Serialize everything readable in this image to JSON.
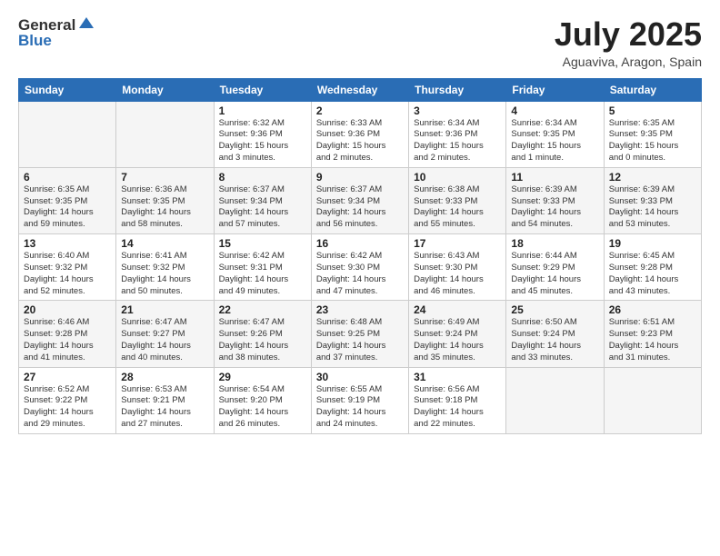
{
  "header": {
    "logo_line1": "General",
    "logo_line2": "Blue",
    "month_year": "July 2025",
    "location": "Aguaviva, Aragon, Spain"
  },
  "weekdays": [
    "Sunday",
    "Monday",
    "Tuesday",
    "Wednesday",
    "Thursday",
    "Friday",
    "Saturday"
  ],
  "weeks": [
    [
      {
        "day": "",
        "info": ""
      },
      {
        "day": "",
        "info": ""
      },
      {
        "day": "1",
        "info": "Sunrise: 6:32 AM\nSunset: 9:36 PM\nDaylight: 15 hours\nand 3 minutes."
      },
      {
        "day": "2",
        "info": "Sunrise: 6:33 AM\nSunset: 9:36 PM\nDaylight: 15 hours\nand 2 minutes."
      },
      {
        "day": "3",
        "info": "Sunrise: 6:34 AM\nSunset: 9:36 PM\nDaylight: 15 hours\nand 2 minutes."
      },
      {
        "day": "4",
        "info": "Sunrise: 6:34 AM\nSunset: 9:35 PM\nDaylight: 15 hours\nand 1 minute."
      },
      {
        "day": "5",
        "info": "Sunrise: 6:35 AM\nSunset: 9:35 PM\nDaylight: 15 hours\nand 0 minutes."
      }
    ],
    [
      {
        "day": "6",
        "info": "Sunrise: 6:35 AM\nSunset: 9:35 PM\nDaylight: 14 hours\nand 59 minutes."
      },
      {
        "day": "7",
        "info": "Sunrise: 6:36 AM\nSunset: 9:35 PM\nDaylight: 14 hours\nand 58 minutes."
      },
      {
        "day": "8",
        "info": "Sunrise: 6:37 AM\nSunset: 9:34 PM\nDaylight: 14 hours\nand 57 minutes."
      },
      {
        "day": "9",
        "info": "Sunrise: 6:37 AM\nSunset: 9:34 PM\nDaylight: 14 hours\nand 56 minutes."
      },
      {
        "day": "10",
        "info": "Sunrise: 6:38 AM\nSunset: 9:33 PM\nDaylight: 14 hours\nand 55 minutes."
      },
      {
        "day": "11",
        "info": "Sunrise: 6:39 AM\nSunset: 9:33 PM\nDaylight: 14 hours\nand 54 minutes."
      },
      {
        "day": "12",
        "info": "Sunrise: 6:39 AM\nSunset: 9:33 PM\nDaylight: 14 hours\nand 53 minutes."
      }
    ],
    [
      {
        "day": "13",
        "info": "Sunrise: 6:40 AM\nSunset: 9:32 PM\nDaylight: 14 hours\nand 52 minutes."
      },
      {
        "day": "14",
        "info": "Sunrise: 6:41 AM\nSunset: 9:32 PM\nDaylight: 14 hours\nand 50 minutes."
      },
      {
        "day": "15",
        "info": "Sunrise: 6:42 AM\nSunset: 9:31 PM\nDaylight: 14 hours\nand 49 minutes."
      },
      {
        "day": "16",
        "info": "Sunrise: 6:42 AM\nSunset: 9:30 PM\nDaylight: 14 hours\nand 47 minutes."
      },
      {
        "day": "17",
        "info": "Sunrise: 6:43 AM\nSunset: 9:30 PM\nDaylight: 14 hours\nand 46 minutes."
      },
      {
        "day": "18",
        "info": "Sunrise: 6:44 AM\nSunset: 9:29 PM\nDaylight: 14 hours\nand 45 minutes."
      },
      {
        "day": "19",
        "info": "Sunrise: 6:45 AM\nSunset: 9:28 PM\nDaylight: 14 hours\nand 43 minutes."
      }
    ],
    [
      {
        "day": "20",
        "info": "Sunrise: 6:46 AM\nSunset: 9:28 PM\nDaylight: 14 hours\nand 41 minutes."
      },
      {
        "day": "21",
        "info": "Sunrise: 6:47 AM\nSunset: 9:27 PM\nDaylight: 14 hours\nand 40 minutes."
      },
      {
        "day": "22",
        "info": "Sunrise: 6:47 AM\nSunset: 9:26 PM\nDaylight: 14 hours\nand 38 minutes."
      },
      {
        "day": "23",
        "info": "Sunrise: 6:48 AM\nSunset: 9:25 PM\nDaylight: 14 hours\nand 37 minutes."
      },
      {
        "day": "24",
        "info": "Sunrise: 6:49 AM\nSunset: 9:24 PM\nDaylight: 14 hours\nand 35 minutes."
      },
      {
        "day": "25",
        "info": "Sunrise: 6:50 AM\nSunset: 9:24 PM\nDaylight: 14 hours\nand 33 minutes."
      },
      {
        "day": "26",
        "info": "Sunrise: 6:51 AM\nSunset: 9:23 PM\nDaylight: 14 hours\nand 31 minutes."
      }
    ],
    [
      {
        "day": "27",
        "info": "Sunrise: 6:52 AM\nSunset: 9:22 PM\nDaylight: 14 hours\nand 29 minutes."
      },
      {
        "day": "28",
        "info": "Sunrise: 6:53 AM\nSunset: 9:21 PM\nDaylight: 14 hours\nand 27 minutes."
      },
      {
        "day": "29",
        "info": "Sunrise: 6:54 AM\nSunset: 9:20 PM\nDaylight: 14 hours\nand 26 minutes."
      },
      {
        "day": "30",
        "info": "Sunrise: 6:55 AM\nSunset: 9:19 PM\nDaylight: 14 hours\nand 24 minutes."
      },
      {
        "day": "31",
        "info": "Sunrise: 6:56 AM\nSunset: 9:18 PM\nDaylight: 14 hours\nand 22 minutes."
      },
      {
        "day": "",
        "info": ""
      },
      {
        "day": "",
        "info": ""
      }
    ]
  ]
}
